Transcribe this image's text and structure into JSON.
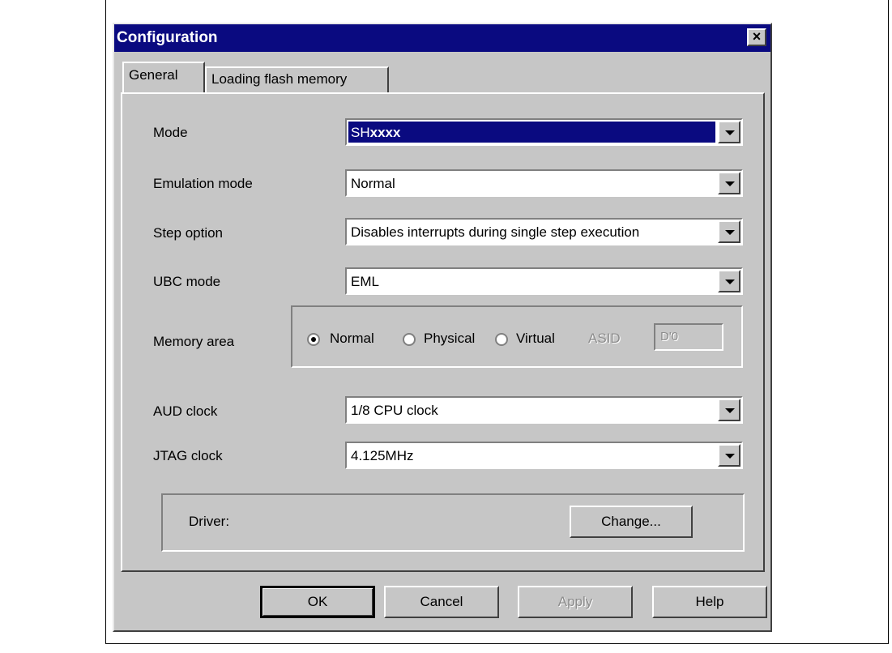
{
  "window": {
    "title": "Configuration",
    "close_label": "×"
  },
  "tabs": [
    {
      "label": "General"
    },
    {
      "label": "Loading flash memory"
    }
  ],
  "fields": {
    "mode": {
      "label": "Mode",
      "value_prefix": "SH",
      "value_bold": "xxxx"
    },
    "emulation_mode": {
      "label": "Emulation mode",
      "value": "Normal"
    },
    "step_option": {
      "label": "Step option",
      "value": "Disables interrupts during single step execution"
    },
    "ubc_mode": {
      "label": "UBC mode",
      "value": "EML"
    },
    "aud_clock": {
      "label": "AUD clock",
      "value": "1/8 CPU clock"
    },
    "jtag_clock": {
      "label": "JTAG clock",
      "value": "4.125MHz"
    }
  },
  "memory_area": {
    "label": "Memory area",
    "options": [
      {
        "label": "Normal",
        "checked": true
      },
      {
        "label": "Physical",
        "checked": false
      },
      {
        "label": "Virtual",
        "checked": false
      }
    ],
    "asid_label": "ASID",
    "asid_value": "D'0"
  },
  "driver": {
    "label": "Driver:",
    "change_button": "Change..."
  },
  "buttons": {
    "ok": "OK",
    "cancel": "Cancel",
    "apply": "Apply",
    "help": "Help"
  }
}
